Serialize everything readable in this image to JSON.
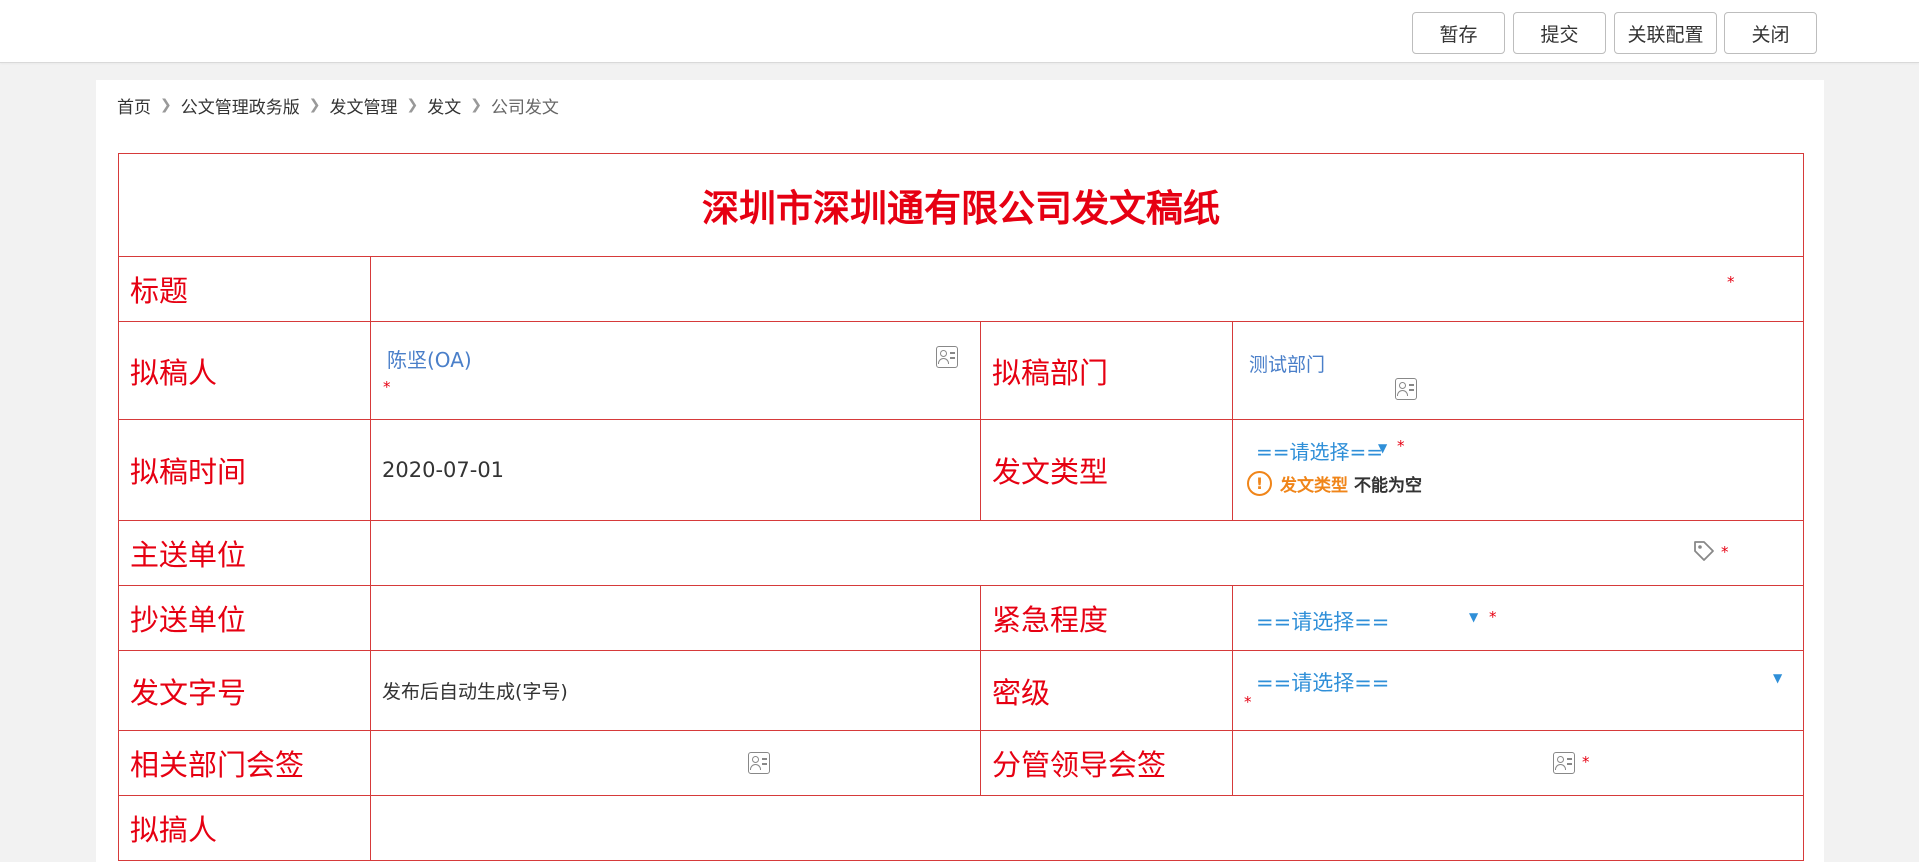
{
  "toolbar": {
    "save_draft": "暂存",
    "submit": "提交",
    "link_config": "关联配置",
    "close": "关闭"
  },
  "breadcrumb": {
    "items": [
      "首页",
      "公文管理政务版",
      "发文管理",
      "发文",
      "公司发文"
    ]
  },
  "form": {
    "title": "深圳市深圳通有限公司发文稿纸",
    "required_mark": "*",
    "fields": {
      "subject": {
        "label": "标题",
        "value": ""
      },
      "drafter": {
        "label": "拟稿人",
        "value": "陈坚(OA)"
      },
      "draft_dept": {
        "label": "拟稿部门",
        "value": "测试部门"
      },
      "draft_time": {
        "label": "拟稿时间",
        "value": "2020-07-01"
      },
      "doc_type": {
        "label": "发文类型",
        "value": "==请选择=="
      },
      "main_recipient": {
        "label": "主送单位",
        "value": ""
      },
      "cc_recipient": {
        "label": "抄送单位",
        "value": ""
      },
      "urgency": {
        "label": "紧急程度",
        "value": "==请选择=="
      },
      "doc_number": {
        "label": "发文字号",
        "value": "发布后自动生成(字号)"
      },
      "secrecy": {
        "label": "密级",
        "value": "==请选择=="
      },
      "dept_cosign": {
        "label": "相关部门会签",
        "value": ""
      },
      "leader_cosign": {
        "label": "分管领导会签",
        "value": ""
      },
      "drafter2": {
        "label": "拟搞人",
        "value": ""
      }
    },
    "validation": {
      "field": "发文类型",
      "message": "不能为空",
      "icon": "exclamation-icon"
    }
  },
  "colors": {
    "form_border": "#d63a3a",
    "label_red": "#e60012",
    "select_blue": "#2f8fd8",
    "warn_orange": "#f08519"
  }
}
